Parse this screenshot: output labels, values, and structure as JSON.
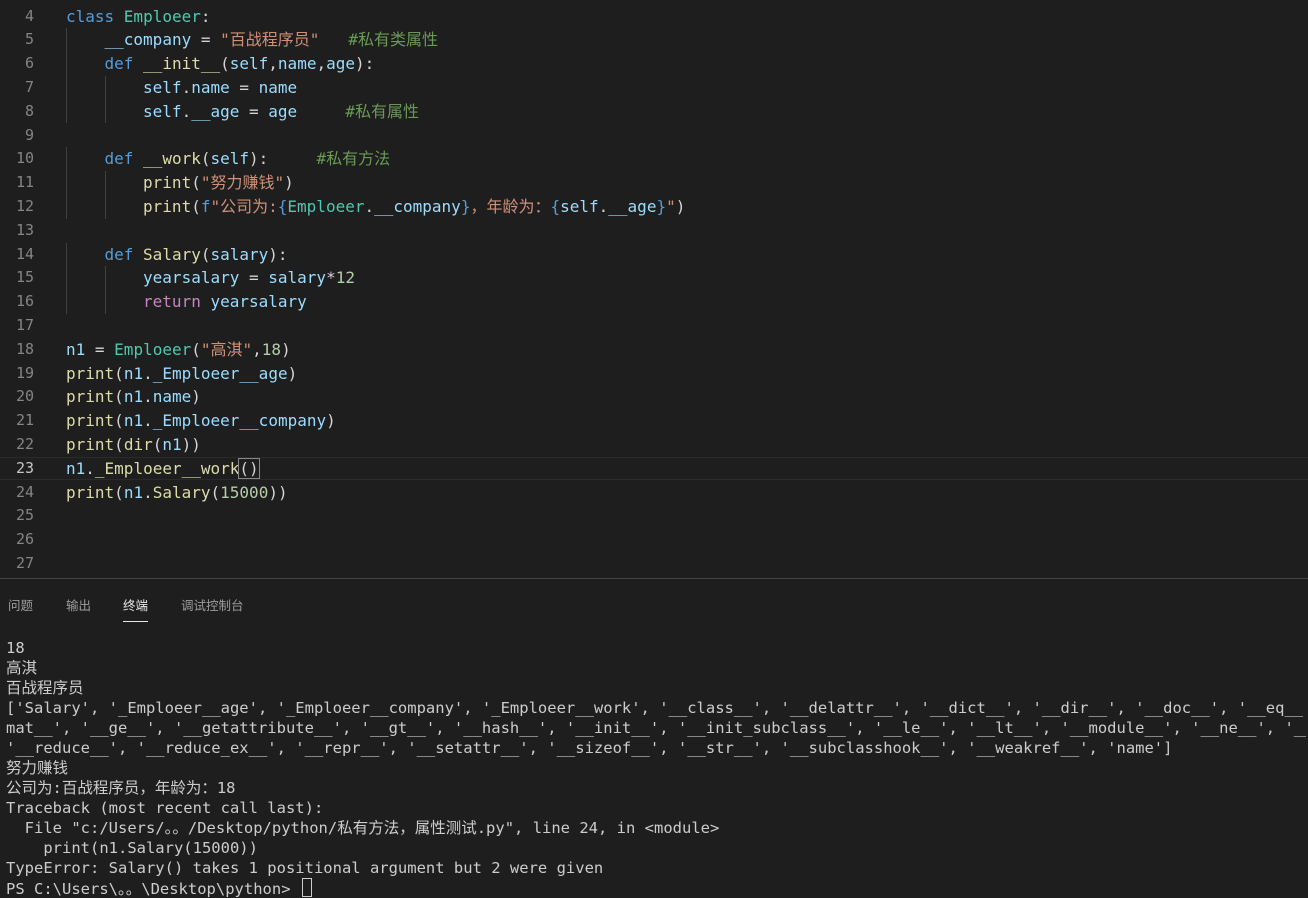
{
  "editor": {
    "lines": [
      {
        "n": "4",
        "indent": 0,
        "tokens": [
          [
            "kw",
            "class "
          ],
          [
            "cls",
            "Emploeer"
          ],
          [
            "pl",
            ":"
          ]
        ]
      },
      {
        "n": "5",
        "indent": 1,
        "tokens": [
          [
            "var",
            "__company"
          ],
          [
            "pl",
            " = "
          ],
          [
            "str",
            "\"百战程序员\""
          ],
          [
            "pl",
            "   "
          ],
          [
            "cmt",
            "#私有类属性"
          ]
        ]
      },
      {
        "n": "6",
        "indent": 1,
        "tokens": [
          [
            "kw",
            "def "
          ],
          [
            "fn",
            "__init__"
          ],
          [
            "pl",
            "("
          ],
          [
            "var",
            "self"
          ],
          [
            "pl",
            ","
          ],
          [
            "var",
            "name"
          ],
          [
            "pl",
            ","
          ],
          [
            "var",
            "age"
          ],
          [
            "pl",
            "):"
          ]
        ]
      },
      {
        "n": "7",
        "indent": 2,
        "tokens": [
          [
            "var",
            "self"
          ],
          [
            "pl",
            "."
          ],
          [
            "var",
            "name"
          ],
          [
            "pl",
            " = "
          ],
          [
            "var",
            "name"
          ]
        ]
      },
      {
        "n": "8",
        "indent": 2,
        "tokens": [
          [
            "var",
            "self"
          ],
          [
            "pl",
            "."
          ],
          [
            "var",
            "__age"
          ],
          [
            "pl",
            " = "
          ],
          [
            "var",
            "age"
          ],
          [
            "pl",
            "     "
          ],
          [
            "cmt",
            "#私有属性"
          ]
        ]
      },
      {
        "n": "9",
        "indent": 0,
        "tokens": []
      },
      {
        "n": "10",
        "indent": 1,
        "tokens": [
          [
            "kw",
            "def "
          ],
          [
            "fn",
            "__work"
          ],
          [
            "pl",
            "("
          ],
          [
            "var",
            "self"
          ],
          [
            "pl",
            "):     "
          ],
          [
            "cmt",
            "#私有方法"
          ]
        ]
      },
      {
        "n": "11",
        "indent": 2,
        "tokens": [
          [
            "fn",
            "print"
          ],
          [
            "pl",
            "("
          ],
          [
            "str",
            "\"努力赚钱\""
          ],
          [
            "pl",
            ")"
          ]
        ]
      },
      {
        "n": "12",
        "indent": 2,
        "tokens": [
          [
            "fn",
            "print"
          ],
          [
            "pl",
            "("
          ],
          [
            "kw",
            "f"
          ],
          [
            "str",
            "\"公司为:"
          ],
          [
            "kw",
            "{"
          ],
          [
            "cls",
            "Emploeer"
          ],
          [
            "pl",
            "."
          ],
          [
            "var",
            "__company"
          ],
          [
            "kw",
            "}"
          ],
          [
            "str",
            "，年龄为："
          ],
          [
            "kw",
            "{"
          ],
          [
            "var",
            "self"
          ],
          [
            "pl",
            "."
          ],
          [
            "var",
            "__age"
          ],
          [
            "kw",
            "}"
          ],
          [
            "str",
            "\""
          ],
          [
            "pl",
            ")"
          ]
        ]
      },
      {
        "n": "13",
        "indent": 0,
        "tokens": []
      },
      {
        "n": "14",
        "indent": 1,
        "tokens": [
          [
            "kw",
            "def "
          ],
          [
            "fn",
            "Salary"
          ],
          [
            "pl",
            "("
          ],
          [
            "var",
            "salary"
          ],
          [
            "pl",
            "):"
          ]
        ]
      },
      {
        "n": "15",
        "indent": 2,
        "tokens": [
          [
            "var",
            "yearsalary"
          ],
          [
            "pl",
            " = "
          ],
          [
            "var",
            "salary"
          ],
          [
            "pl",
            "*"
          ],
          [
            "num",
            "12"
          ]
        ]
      },
      {
        "n": "16",
        "indent": 2,
        "tokens": [
          [
            "ctrl",
            "return "
          ],
          [
            "var",
            "yearsalary"
          ]
        ]
      },
      {
        "n": "17",
        "indent": 0,
        "tokens": []
      },
      {
        "n": "18",
        "indent": 0,
        "tokens": [
          [
            "var",
            "n1"
          ],
          [
            "pl",
            " = "
          ],
          [
            "cls",
            "Emploeer"
          ],
          [
            "pl",
            "("
          ],
          [
            "str",
            "\"高淇\""
          ],
          [
            "pl",
            ","
          ],
          [
            "num",
            "18"
          ],
          [
            "pl",
            ")"
          ]
        ]
      },
      {
        "n": "19",
        "indent": 0,
        "tokens": [
          [
            "fn",
            "print"
          ],
          [
            "pl",
            "("
          ],
          [
            "var",
            "n1"
          ],
          [
            "pl",
            "."
          ],
          [
            "var",
            "_Emploeer__age"
          ],
          [
            "pl",
            ")"
          ]
        ]
      },
      {
        "n": "20",
        "indent": 0,
        "tokens": [
          [
            "fn",
            "print"
          ],
          [
            "pl",
            "("
          ],
          [
            "var",
            "n1"
          ],
          [
            "pl",
            "."
          ],
          [
            "var",
            "name"
          ],
          [
            "pl",
            ")"
          ]
        ]
      },
      {
        "n": "21",
        "indent": 0,
        "tokens": [
          [
            "fn",
            "print"
          ],
          [
            "pl",
            "("
          ],
          [
            "var",
            "n1"
          ],
          [
            "pl",
            "."
          ],
          [
            "var",
            "_Emploeer__company"
          ],
          [
            "pl",
            ")"
          ]
        ]
      },
      {
        "n": "22",
        "indent": 0,
        "tokens": [
          [
            "fn",
            "print"
          ],
          [
            "pl",
            "("
          ],
          [
            "fn",
            "dir"
          ],
          [
            "pl",
            "("
          ],
          [
            "var",
            "n1"
          ],
          [
            "pl",
            "))"
          ]
        ]
      },
      {
        "n": "23",
        "indent": 0,
        "current": true,
        "tokens": [
          [
            "var",
            "n1"
          ],
          [
            "pl",
            "."
          ],
          [
            "fn",
            "_Emploeer__work"
          ],
          [
            "bracket",
            "()"
          ]
        ]
      },
      {
        "n": "24",
        "indent": 0,
        "tokens": [
          [
            "fn",
            "print"
          ],
          [
            "pl",
            "("
          ],
          [
            "var",
            "n1"
          ],
          [
            "pl",
            "."
          ],
          [
            "fn",
            "Salary"
          ],
          [
            "pl",
            "("
          ],
          [
            "num",
            "15000"
          ],
          [
            "pl",
            "))"
          ]
        ]
      },
      {
        "n": "25",
        "indent": 0,
        "tokens": []
      },
      {
        "n": "26",
        "indent": 0,
        "tokens": []
      },
      {
        "n": "27",
        "indent": 0,
        "tokens": []
      }
    ]
  },
  "panel": {
    "tabs": [
      {
        "label": "问题",
        "active": false
      },
      {
        "label": "输出",
        "active": false
      },
      {
        "label": "终端",
        "active": true
      },
      {
        "label": "调试控制台",
        "active": false
      }
    ]
  },
  "terminal": {
    "lines": [
      "18",
      "高淇",
      "百战程序员",
      "['Salary', '_Emploeer__age', '_Emploeer__company', '_Emploeer__work', '__class__', '__delattr__', '__dict__', '__dir__', '__doc__', '__eq__', '__for",
      "mat__', '__ge__', '__getattribute__', '__gt__', '__hash__', '__init__', '__init_subclass__', '__le__', '__lt__', '__module__', '__ne__', '__new__',",
      "'__reduce__', '__reduce_ex__', '__repr__', '__setattr__', '__sizeof__', '__str__', '__subclasshook__', '__weakref__', 'name']",
      "努力赚钱",
      "公司为:百战程序员，年龄为：18",
      "Traceback (most recent call last):",
      "  File \"c:/Users/。。/Desktop/python/私有方法，属性测试.py\", line 24, in <module>",
      "    print(n1.Salary(15000))",
      "TypeError: Salary() takes 1 positional argument but 2 were given",
      "PS C:\\Users\\。。\\Desktop\\python> "
    ]
  }
}
